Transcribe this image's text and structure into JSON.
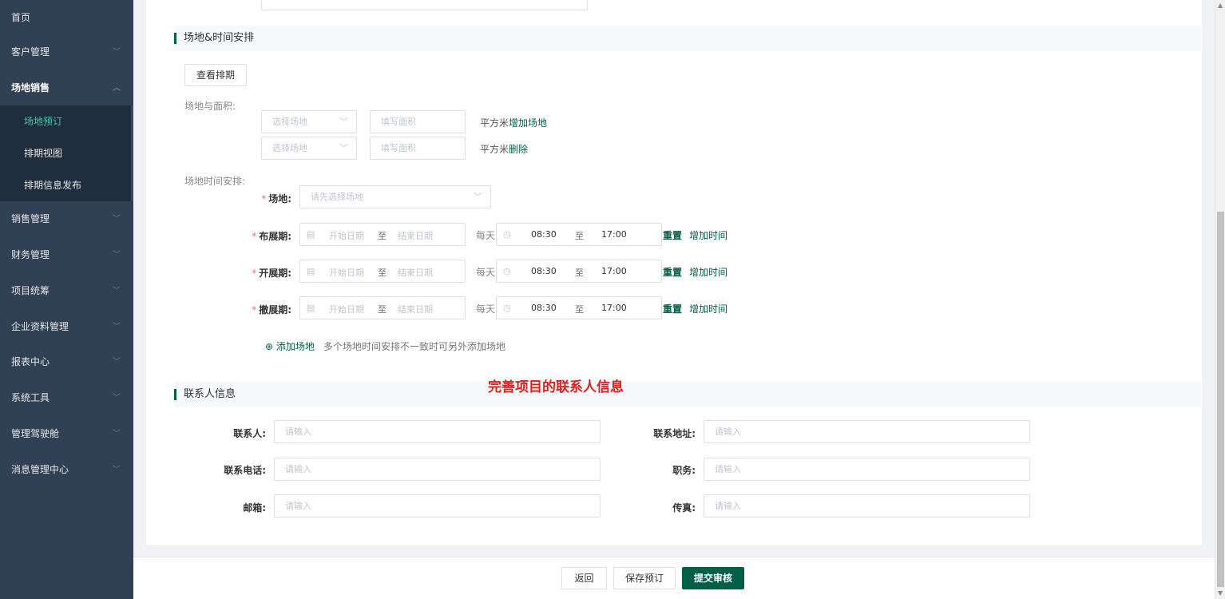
{
  "sidebar": {
    "items": [
      {
        "label": "首页"
      },
      {
        "label": "客户管理"
      },
      {
        "label": "场地销售"
      },
      {
        "label": "销售管理"
      },
      {
        "label": "财务管理"
      },
      {
        "label": "项目统筹"
      },
      {
        "label": "企业资料管理"
      },
      {
        "label": "报表中心"
      },
      {
        "label": "系统工具"
      },
      {
        "label": "管理驾驶舱"
      },
      {
        "label": "消息管理中心"
      }
    ],
    "sub_items": [
      {
        "label": "场地预订"
      },
      {
        "label": "排期视图"
      },
      {
        "label": "排期信息发布"
      }
    ],
    "active_sub": "场地预订"
  },
  "venue_section": {
    "title": "场地&时间安排",
    "view_schedule_button": "查看排期",
    "area_label": "场地与面积:",
    "rows": [
      {
        "venue_placeholder": "选择场地",
        "area_placeholder": "填写面积",
        "unit": "平方米",
        "action": "增加场地"
      },
      {
        "venue_placeholder": "选择场地",
        "area_placeholder": "填写面积",
        "unit": "平方米",
        "action": "删除"
      }
    ],
    "time_label": "场地时间安排:",
    "venue_field_label": "场地:",
    "venue_field_placeholder": "请先选择场地",
    "periods": [
      {
        "label": "布展期:",
        "start_placeholder": "开始日期",
        "to": "至",
        "end_placeholder": "结束日期",
        "daily": "每天",
        "start_time": "08:30",
        "end_time": "17:00",
        "reset": "重置",
        "add_time": "增加时间"
      },
      {
        "label": "开展期:",
        "start_placeholder": "开始日期",
        "to": "至",
        "end_placeholder": "结束日期",
        "daily": "每天",
        "start_time": "08:30",
        "end_time": "17:00",
        "reset": "重置",
        "add_time": "增加时间"
      },
      {
        "label": "撤展期:",
        "start_placeholder": "开始日期",
        "to": "至",
        "end_placeholder": "结束日期",
        "daily": "每天",
        "start_time": "08:30",
        "end_time": "17:00",
        "reset": "重置",
        "add_time": "增加时间"
      }
    ],
    "add_venue_link": "添加场地",
    "add_venue_hint": "多个场地时间安排不一致时可另外添加场地"
  },
  "annotation": "完善项目的联系人信息",
  "contact_section": {
    "title": "联系人信息",
    "fields": [
      {
        "label": "联系人:",
        "placeholder": "请输入"
      },
      {
        "label": "联系地址:",
        "placeholder": "请输入"
      },
      {
        "label": "联系电话:",
        "placeholder": "请输入"
      },
      {
        "label": "职务:",
        "placeholder": "请输入"
      },
      {
        "label": "邮箱:",
        "placeholder": "请输入"
      },
      {
        "label": "传真:",
        "placeholder": "请输入"
      }
    ]
  },
  "footer": {
    "back": "返回",
    "save": "保存预订",
    "submit": "提交审核"
  },
  "colors": {
    "sidebar_bg": "#304156",
    "accent": "#005f46",
    "required": "#f56c6c",
    "annotation": "#e02020"
  }
}
